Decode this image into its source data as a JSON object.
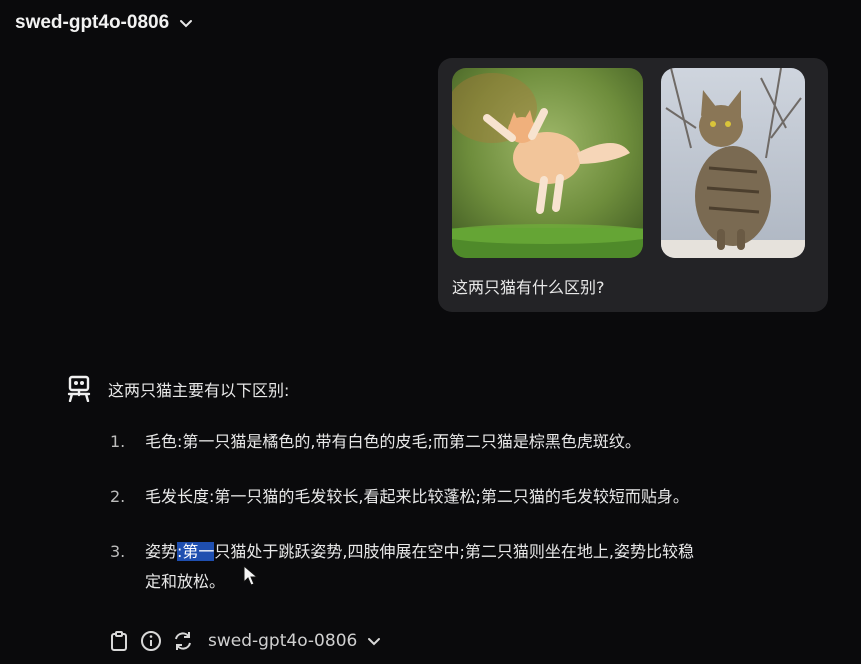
{
  "header": {
    "model_name": "swed-gpt4o-0806",
    "chevron_icon": "chevron-down-icon"
  },
  "user_message": {
    "text": "这两只猫有什么区别?",
    "images": [
      {
        "name": "jumping-orange-cat-image"
      },
      {
        "name": "sitting-tabby-cat-image"
      }
    ]
  },
  "assistant_message": {
    "icon": "robot-icon",
    "intro": "这两只猫主要有以下区别:",
    "items": [
      {
        "num": "1.",
        "text": "毛色:第一只猫是橘色的,带有白色的皮毛;而第二只猫是棕黑色虎斑纹。"
      },
      {
        "num": "2.",
        "text": "毛发长度:第一只猫的毛发较长,看起来比较蓬松;第二只猫的毛发较短而贴身。"
      },
      {
        "num": "3.",
        "pre": "姿势",
        "highlight": ":第一",
        "post_line1": "只猫处于跳跃姿势,四肢伸展在空中;第二只猫则坐在地上,姿势比较稳",
        "post_line2": "定和放松。"
      }
    ]
  },
  "footer": {
    "icons": [
      "clipboard-icon",
      "info-icon",
      "refresh-icon"
    ],
    "model_name": "swed-gpt4o-0806",
    "chevron_icon": "chevron-down-icon"
  },
  "colors": {
    "background": "#0a0a0c",
    "bubble": "#232326",
    "highlight": "#1f4fb0"
  }
}
